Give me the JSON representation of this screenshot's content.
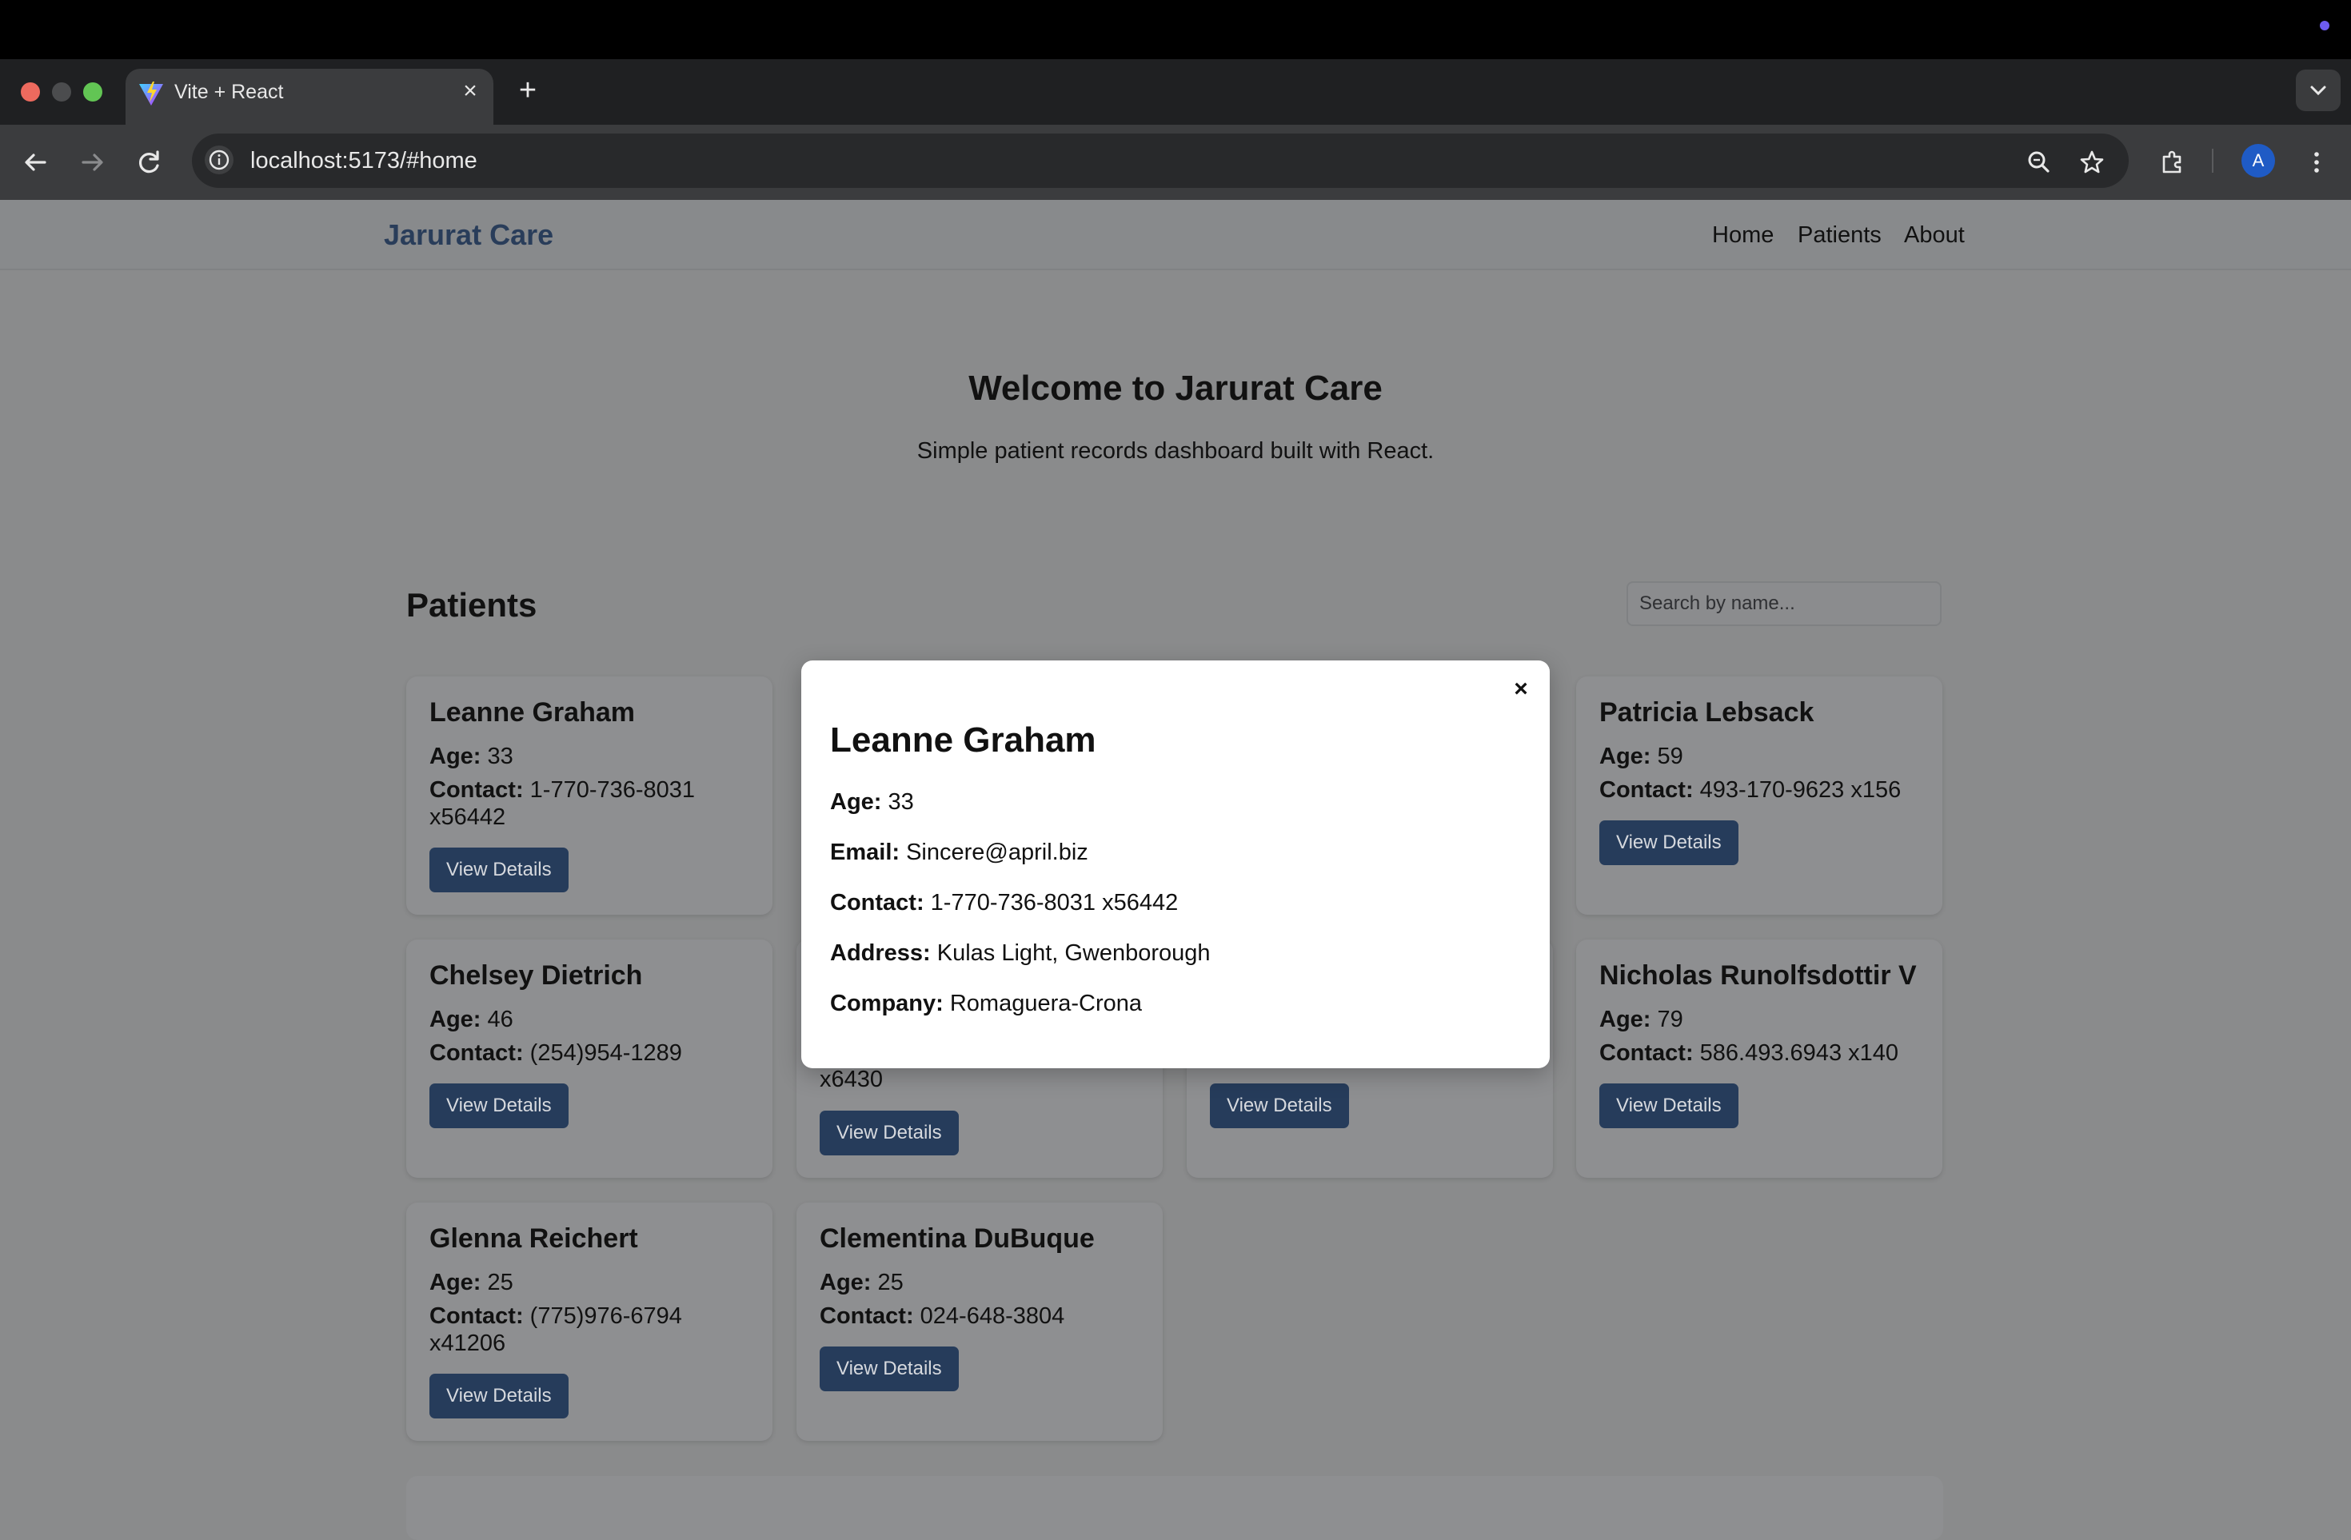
{
  "browser": {
    "tab_title": "Vite + React",
    "tab_close": "×",
    "new_tab": "+",
    "url": "localhost:5173/#home",
    "profile_initial": "A"
  },
  "header": {
    "brand": "Jarurat Care",
    "nav": [
      "Home",
      "Patients",
      "About"
    ]
  },
  "hero": {
    "title": "Welcome to Jarurat Care",
    "subtitle": "Simple patient records dashboard built with React."
  },
  "patients_section": {
    "title": "Patients",
    "search_placeholder": "Search by name...",
    "age_label": "Age:",
    "contact_label": "Contact:",
    "button_label": "View Details",
    "cards": [
      {
        "name": "Leanne Graham",
        "age": "33",
        "contact": "1-770-736-8031 x56442"
      },
      {
        "name": "Patricia Lebsack",
        "age": "59",
        "contact": "493-170-9623 x156"
      },
      {
        "name": "Chelsey Dietrich",
        "age": "46",
        "contact": "(254)954-1289"
      },
      {
        "name": "Nicholas Runolfsdottir V",
        "age": "79",
        "contact": "586.493.6943 x140"
      },
      {
        "name": "Glenna Reichert",
        "age": "25",
        "contact": "(775)976-6794 x41206"
      },
      {
        "name": "Clementina DuBuque",
        "age": "25",
        "contact": "024-648-3804"
      }
    ],
    "partially_hidden_text": "x6430"
  },
  "modal": {
    "close": "×",
    "name": "Leanne Graham",
    "fields": [
      {
        "label": "Age:",
        "value": "33"
      },
      {
        "label": "Email:",
        "value": "Sincere@april.biz"
      },
      {
        "label": "Contact:",
        "value": "1-770-736-8031 x56442"
      },
      {
        "label": "Address:",
        "value": "Kulas Light, Gwenborough"
      },
      {
        "label": "Company:",
        "value": "Romaguera-Crona"
      }
    ]
  },
  "colors": {
    "brand": "#293d5a",
    "button": "#263c5b",
    "overlay_bg": "#8a8b8c",
    "modal_bg": "#ffffff"
  }
}
